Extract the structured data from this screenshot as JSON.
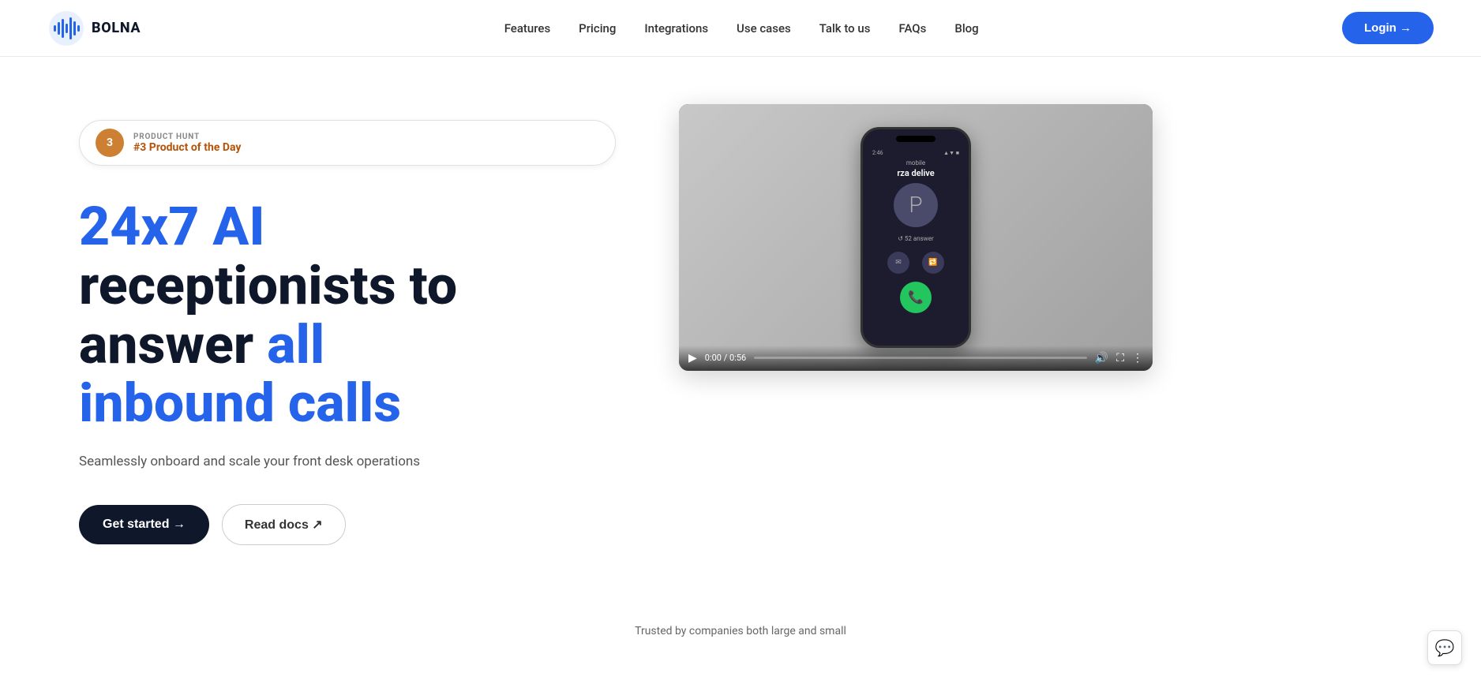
{
  "nav": {
    "logo_text": "BOLNA",
    "links": [
      {
        "label": "Features",
        "href": "#"
      },
      {
        "label": "Pricing",
        "href": "#"
      },
      {
        "label": "Integrations",
        "href": "#"
      },
      {
        "label": "Use cases",
        "href": "#"
      },
      {
        "label": "Talk to us",
        "href": "#"
      },
      {
        "label": "FAQs",
        "href": "#"
      },
      {
        "label": "Blog",
        "href": "#"
      }
    ],
    "login_label": "Login →"
  },
  "product_hunt": {
    "label": "PRODUCT HUNT",
    "badge_number": "3",
    "title": "#3 Product of the Day"
  },
  "hero": {
    "heading_line1": "24x7 AI",
    "heading_line2": "receptionists to",
    "heading_line3_prefix": "answer ",
    "heading_line3_blue": "all",
    "heading_line4": "inbound calls",
    "subheading": "Seamlessly onboard and scale your front desk operations",
    "cta_primary": "Get started →",
    "cta_secondary": "Read docs ↗"
  },
  "video": {
    "phone_status_time": "2:46",
    "phone_status_right": "▲▼ ■",
    "phone_label": "mobile",
    "phone_caller": "rza delive",
    "phone_big_letter": "P",
    "phone_timer": "↺ 52 answer",
    "phone_action1": "✉",
    "phone_action2": "📞",
    "time_current": "0:00",
    "time_total": "0:56"
  },
  "trusted": {
    "text": "Trusted by companies both large and small"
  },
  "chat_widget": {
    "icon": "💬"
  }
}
